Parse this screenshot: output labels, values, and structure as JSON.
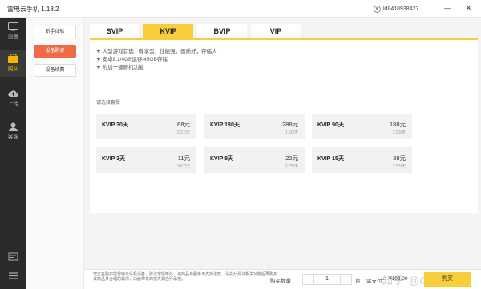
{
  "app": {
    "title": "雷电云手机 1.18.2",
    "user_id": "ld8418938427"
  },
  "colors": {
    "accent": "#f8cf3a",
    "sidebar_bg": "#2a2a2a",
    "active_sub": "#f06a45"
  },
  "sidebar": {
    "items": [
      {
        "label": "设备",
        "icon": "device-icon"
      },
      {
        "label": "购买",
        "icon": "cart-icon"
      },
      {
        "label": "上传",
        "icon": "upload-icon"
      },
      {
        "label": "客服",
        "icon": "support-icon"
      }
    ],
    "active": "购买"
  },
  "subnav": {
    "items": [
      "新手体验",
      "设备购买",
      "设备续费"
    ],
    "active": "设备购买"
  },
  "tabs": {
    "items": [
      "SVIP",
      "KVIP",
      "BVIP",
      "VIP"
    ],
    "active": "KVIP"
  },
  "features": [
    "★ 大型游戏首选，尊享型，性能强，画质好，存储大",
    "★ 安卓8.1/4GB运存/45GB存储",
    "★ 附加一键新机功能"
  ],
  "packages": {
    "title": "请选择套餐",
    "cards": [
      {
        "name": "KVIP 30天",
        "price": "68元",
        "unit": "2.27/天"
      },
      {
        "name": "KVIP 180天",
        "price": "288元",
        "unit": "1.60/天"
      },
      {
        "name": "KVIP 90天",
        "price": "188元",
        "unit": "2.09/天"
      },
      {
        "name": "KVIP 3天",
        "price": "11元",
        "unit": "3.67/天"
      },
      {
        "name": "KVIP 8天",
        "price": "22元",
        "unit": "2.75/天"
      },
      {
        "name": "KVIP 15天",
        "price": "38元",
        "unit": "2.53/天"
      }
    ]
  },
  "footer": {
    "notice": "您正在购买的雷电云手机设备，除法定情形外，该商品与服务不支持退款，请充分测试相关功能后再购买该商品并合理的需求，由此带来的损失需自行承担。",
    "qty_label": "购买数量",
    "qty_value": "1",
    "qty_unit": "台",
    "pay_label": "需支付：",
    "pay_total": "¥109.00",
    "watermark": "知乎 @Oreo",
    "buy_label": "购买"
  }
}
